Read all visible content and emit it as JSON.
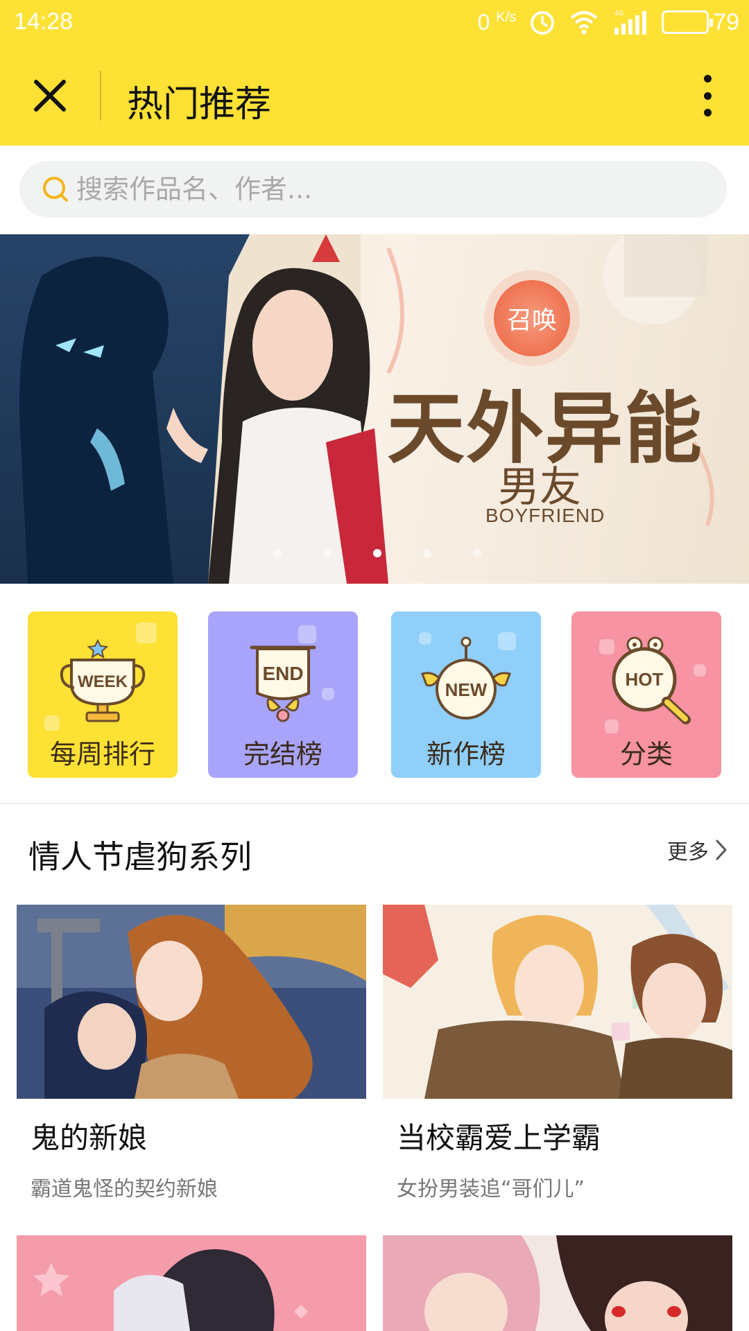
{
  "status_bar": {
    "time": "14:28",
    "net_speed": "0",
    "net_speed_unit": "K/s",
    "battery": "79",
    "battery_level": 0.79
  },
  "header": {
    "title": "热门推荐"
  },
  "search": {
    "placeholder": "搜索作品名、作者..."
  },
  "banner": {
    "badge": "召唤",
    "title": "天外异能",
    "subtitle": "男友",
    "english": "BOYFRIEND",
    "active_index": 2,
    "count": 5
  },
  "categories": [
    {
      "label": "每周排行",
      "badge": "WEEK",
      "color": "#FDE135"
    },
    {
      "label": "完结榜",
      "badge": "END",
      "color": "#A8A4FB"
    },
    {
      "label": "新作榜",
      "badge": "NEW",
      "color": "#8FCFFA"
    },
    {
      "label": "分类",
      "badge": "HOT",
      "color": "#F793A3"
    }
  ],
  "section": {
    "title": "情人节虐狗系列",
    "more": "更多"
  },
  "comics": [
    {
      "title": "鬼的新娘",
      "desc": "霸道鬼怪的契约新娘"
    },
    {
      "title": "当校霸爱上学霸",
      "desc": "女扮男装追“哥们儿”"
    }
  ],
  "colors": {
    "accent": "#FDE135"
  }
}
